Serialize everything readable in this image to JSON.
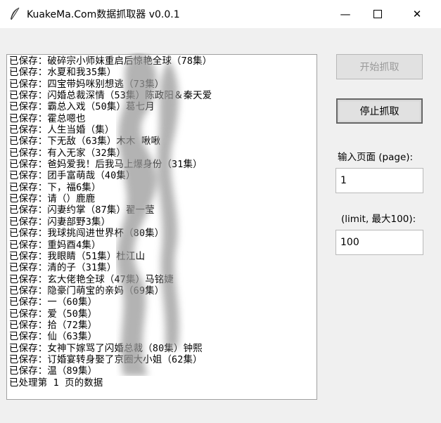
{
  "window": {
    "title": "KuakeMa.Com数据抓取器   v0.0.1",
    "minimize": "—",
    "close": "✕"
  },
  "log": {
    "lines": [
      "已保存：破碎宗小师妹重启后惊艳全球（78集）",
      "已保存：水夏和我35集）",
      "已保存：四宝带妈咪别想逃（73集）",
      "已保存：闪婚总裁深情（53集）陈政阳＆秦天爱",
      "已保存：霸总入戏（50集）葛七月",
      "已保存：霍总嗯也",
      "已保存：人生当婚（集）",
      "已保存：下无敌（63集）木木 啾啾",
      "已保存：有入无家（32集）",
      "已保存：爸妈爱我！后我马上爆身份（31集）",
      "已保存：团手富萌哉（40集）",
      "已保存：下，福6集）",
      "已保存：请（）鹿鹿",
      "已保存：闪妻约掌（87集）翟一莹",
      "已保存：闪妻部野3集）",
      "已保存：我球挑闯进世界杯（80集）",
      "已保存：重妈酉4集）",
      "已保存：我眼睛（51集）杜江山",
      "已保存：清的子（31集）",
      "已保存：玄大佬艳全球（47集）马铭婕",
      "已保存：隐豪门萌宝的亲妈（69集）",
      "已保存：一（60集）",
      "已保存：爱（50集）",
      "已保存：拾（72集）",
      "已保存：仙（63集）",
      "已保存：女神下嫁骂了闪婚总裁（80集）钟熙",
      "已保存：订婚宴转身娶了京圈大小姐（62集）",
      "已保存：温（89集）",
      "已处理第 1 页的数据"
    ]
  },
  "controls": {
    "start_label": "开始抓取",
    "stop_label": "停止抓取",
    "page_label": "输入页面 (page):",
    "page_value": "1",
    "limit_label": "(limit, 最大100):",
    "limit_value": "100"
  },
  "colors": {
    "background": "#f0f0f0",
    "disabled_text": "#9a9a9a"
  },
  "icons": {
    "app": "feather-icon",
    "minimize": "minimize-icon",
    "maximize": "maximize-icon",
    "close": "close-icon"
  }
}
